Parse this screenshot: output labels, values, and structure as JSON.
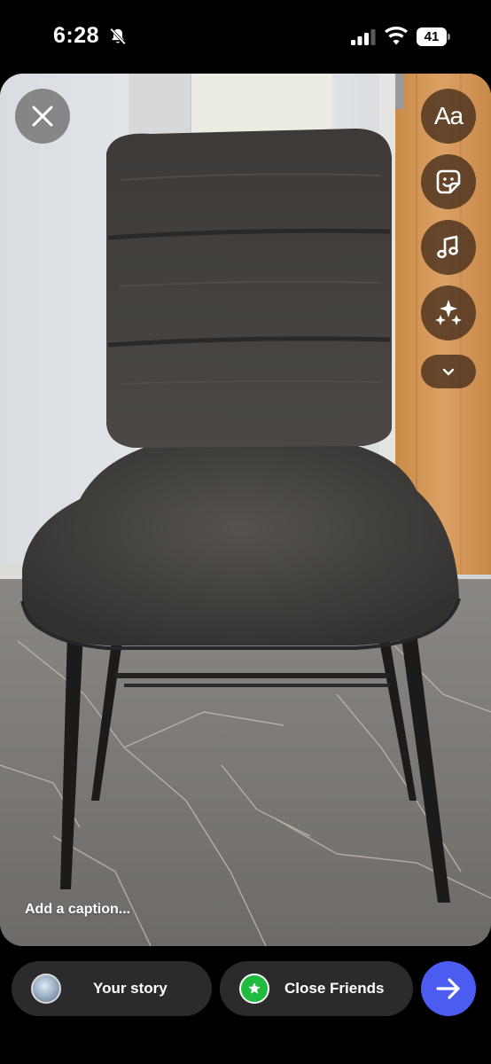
{
  "status_bar": {
    "time": "6:28",
    "battery_level": "41",
    "icons": [
      "mute-bell-icon",
      "cellular-signal-icon",
      "wifi-icon",
      "battery-icon"
    ]
  },
  "story_editor": {
    "tools": {
      "text_label": "Aa",
      "icons": [
        "close-icon",
        "text-tool",
        "sticker-icon",
        "music-note-icon",
        "sparkles-icon",
        "chevron-down-icon"
      ]
    },
    "caption_placeholder": "Add a caption..."
  },
  "share_bar": {
    "your_story_label": "Your story",
    "close_friends_label": "Close Friends",
    "close_friends_color": "#1fbb3e",
    "send_color": "#4b5cf0",
    "send_icon": "arrow-right-icon"
  }
}
